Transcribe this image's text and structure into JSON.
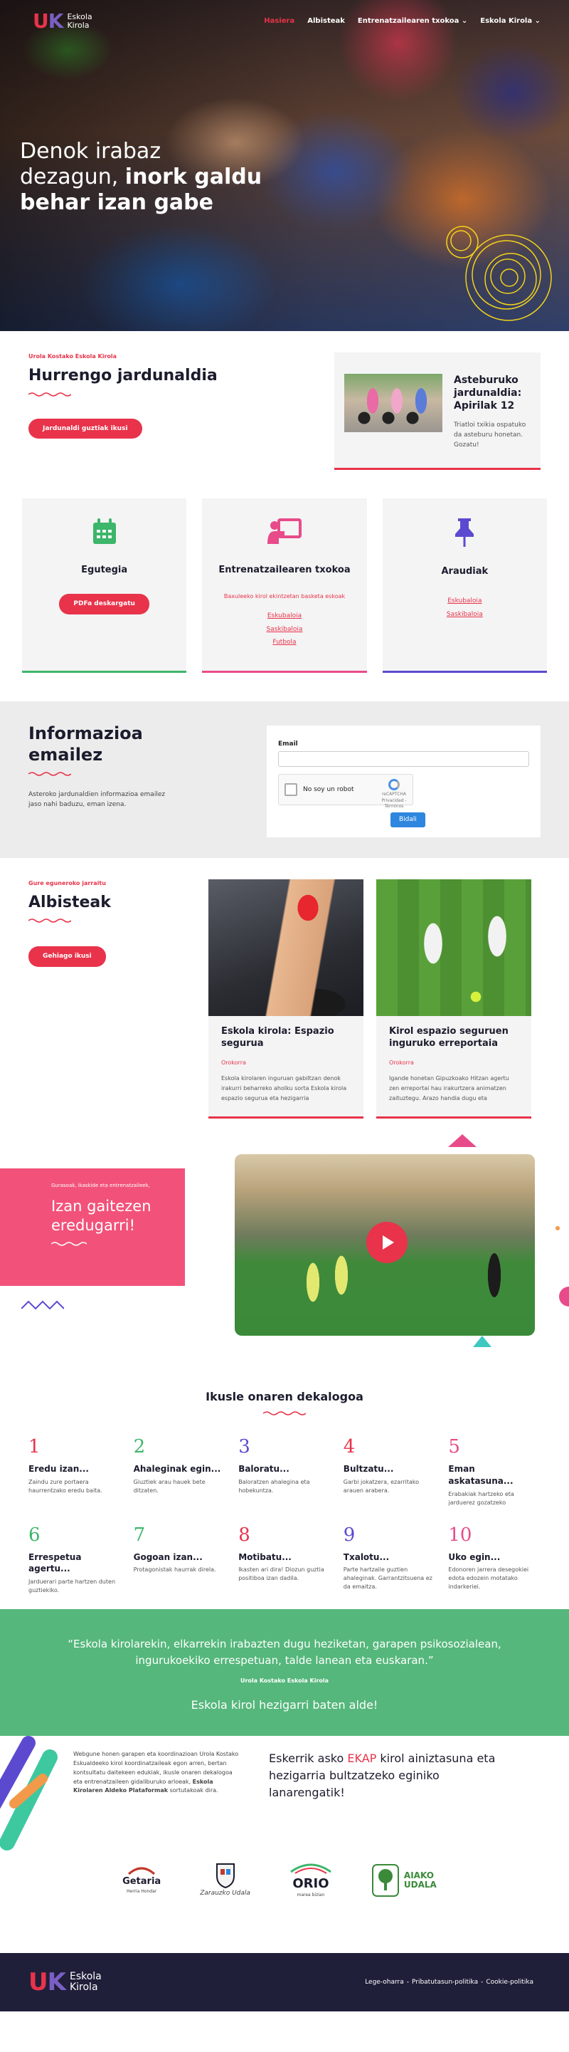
{
  "header": {
    "logo_letters": [
      "U",
      "K"
    ],
    "logo_text": [
      "Eskola",
      "Kirola"
    ],
    "nav": [
      {
        "label": "Hasiera",
        "active": true
      },
      {
        "label": "Albisteak",
        "active": false
      },
      {
        "label": "Entrenatzailearen txokoa",
        "dropdown": true
      },
      {
        "label": "Eskola Kirola",
        "dropdown": true
      }
    ]
  },
  "hero": {
    "title_line1": "Denok irabaz",
    "title_line2_a": "dezagun, ",
    "title_line2_b": "inork galdu",
    "title_line3": "behar izan gabe"
  },
  "next_round": {
    "kicker": "Urola Kostako Eskola Kirola",
    "title": "Hurrengo jardunaldia",
    "button": "Jardunaldi guztiak ikusi",
    "card": {
      "title": "Asteburuko jardunaldia: Apirilak 12",
      "text": "Triatloi txikia ospatuko da asteburu honetan. Gozatu!"
    }
  },
  "features": [
    {
      "icon": "calendar-icon",
      "title": "Egutegia",
      "button": "PDFa deskargatu",
      "color": "#3cb66a"
    },
    {
      "icon": "coach-board-icon",
      "title": "Entrenatzailearen txokoa",
      "subtitle": "Baxuleeko kirol ekintzetan basketa eskoak",
      "links": [
        "Eskubaloia",
        "Saskibaloia",
        "Futbola"
      ],
      "color": "#e84b8a"
    },
    {
      "icon": "pushpin-icon",
      "title": "Araudiak",
      "links": [
        "Eskubaloia",
        "Saskibaloia"
      ],
      "color": "#5b4ad0"
    }
  ],
  "newsletter": {
    "title_line1": "Informazioa",
    "title_line2": "emailez",
    "text": "Asteroko jardunaldien informazioa emailez jaso nahi baduzu, eman izena.",
    "email_label": "Email",
    "captcha_label": "No soy un robot",
    "captcha_brand": "reCAPTCHA",
    "captcha_sub": "Privacidad - Términos",
    "submit": "Bidali"
  },
  "news": {
    "kicker": "Gure eguneroko jarraitu",
    "title": "Albisteak",
    "button": "Gehiago ikusi",
    "posts": [
      {
        "title": "Eskola kirola: Espazio segurua",
        "category": "Orokorra",
        "excerpt": "Eskola kirolaren inguruan gabiltzan denok irakurri beharreko aholku sorta Eskola kirola espazio segurua eta hezigarria"
      },
      {
        "title": "Kirol espazio seguruen inguruko erreportaia",
        "category": "Orokorra",
        "excerpt": "Igande honetan Gipuzkoako Hitzan agertu zen erreportai hau irakurtzera animatzen zaituztegu. Arazo handia dugu eta"
      }
    ]
  },
  "example": {
    "small": "Gurasoak, ikaskide eta entrenatzaileek,",
    "title_line1": "Izan gaitezen",
    "title_line2": "eredugarri!"
  },
  "decalogue": {
    "title": "Ikusle onaren dekalogoa",
    "items": [
      {
        "num": "1",
        "title": "Eredu izan...",
        "text": "Zaindu zure portaera haurrentzako eredu baita.",
        "color": "#e8334a"
      },
      {
        "num": "2",
        "title": "Ahaleginak egin...",
        "text": "Giuztiek arau hauek bete ditzaten.",
        "color": "#3cb66a"
      },
      {
        "num": "3",
        "title": "Baloratu...",
        "text": "Baloratzen ahalegina eta hobekuntza.",
        "color": "#5b4ad0"
      },
      {
        "num": "4",
        "title": "Bultzatu...",
        "text": "Garbi jokatzera, ezarritako arauen arabera.",
        "color": "#e8334a"
      },
      {
        "num": "5",
        "title": "Eman askatasuna...",
        "text": "Erabakiak hartzeko eta jarduerez gozatzeko",
        "color": "#e84b8a"
      },
      {
        "num": "6",
        "title": "Errespetua agertu...",
        "text": "Jarduerari parte hartzen duten guztiekiko.",
        "color": "#3cb66a"
      },
      {
        "num": "7",
        "title": "Gogoan izan...",
        "text": "Protagonistak haurrak direla.",
        "color": "#3cb66a"
      },
      {
        "num": "8",
        "title": "Motibatu...",
        "text": "Ikasten ari dira! Diozun guztia positiboa izan dadila.",
        "color": "#e8334a"
      },
      {
        "num": "9",
        "title": "Txalotu...",
        "text": "Parte hartzaile guztien ahaleginak. Garrantzitsuena ez da emaitza.",
        "color": "#5b4ad0"
      },
      {
        "num": "10",
        "title": "Uko egin...",
        "text": "Edonoren jarrera desegokiei edota edozein motatako indarkeriei.",
        "color": "#e84b8a"
      }
    ]
  },
  "quote": {
    "text": "“Eskola kirolarekin, elkarrekin irabazten dugu heziketan, garapen psikosozialean, ingurukoekiko errespetuan, talde lanean eta euskaran.”",
    "author": "Urola Kostako Eskola Kirola",
    "slogan": "Eskola kirol hezigarri baten alde!"
  },
  "credits": {
    "text_a": "Webgune honen garapen eta koordinazioan Urola Kostako Eskualdeeko kirol koordinatzaileak egon arren, bertan kontsultatu daitekeen edukiak, ikuslе onaren dekalogoa eta entrenatzaileen gidaliburuko arloeak, ",
    "text_b": "Eskola Kirolaren Aldeko Plataformak",
    "text_c": " sortutakoak dira.",
    "thanks_a": "Eskerrik asko ",
    "thanks_hl": "EKAP",
    "thanks_b": " kirol ainiztasuna eta hezigarria bultzatzeko eginiko lanarengatik!"
  },
  "sponsors": [
    {
      "name": "Getaria",
      "sub": "Herria Hondar",
      "icon": "getaria-logo"
    },
    {
      "name": "Zarauzko Udala",
      "sub": "",
      "icon": "zarautz-shield-icon"
    },
    {
      "name": "ORIO",
      "sub": "marea bizian",
      "icon": "orio-logo"
    },
    {
      "name": "AIAKO UDALA",
      "sub": "",
      "icon": "aia-tree-logo"
    }
  ],
  "footer": {
    "links": [
      "Lege-oharra",
      "Pribatutasun-politika",
      "Cookie-politika"
    ]
  }
}
